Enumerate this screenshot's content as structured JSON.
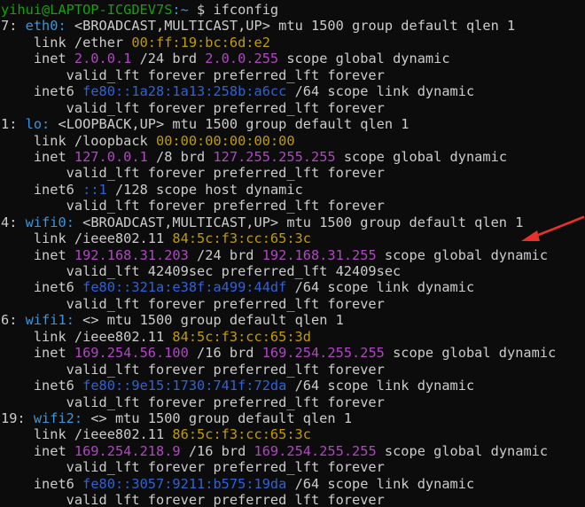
{
  "prompt": {
    "user_host": "yihui@LAPTOP-ICGDEV7S",
    "path": ":~",
    "symbol": " $ ",
    "command": "ifconfig"
  },
  "lines": [
    [
      {
        "t": "7: ",
        "c": "white"
      },
      {
        "t": "eth0:",
        "c": "cyan"
      },
      {
        "t": " <BROADCAST,MULTICAST,UP> mtu 1500 group default qlen 1",
        "c": "white"
      }
    ],
    [
      {
        "t": "    link /ether ",
        "c": "white"
      },
      {
        "t": "00:ff:19:bc:6d:e2",
        "c": "yellow"
      }
    ],
    [
      {
        "t": "    inet ",
        "c": "white"
      },
      {
        "t": "2.0.0.1",
        "c": "magenta"
      },
      {
        "t": " /24 brd ",
        "c": "white"
      },
      {
        "t": "2.0.0.255",
        "c": "magenta"
      },
      {
        "t": " scope global dynamic",
        "c": "white"
      }
    ],
    [
      {
        "t": "        valid_lft forever preferred_lft forever",
        "c": "white"
      }
    ],
    [
      {
        "t": "    inet6 ",
        "c": "white"
      },
      {
        "t": "fe80::1a28:1a13:258b:a6cc",
        "c": "blue"
      },
      {
        "t": " /64 scope link dynamic",
        "c": "white"
      }
    ],
    [
      {
        "t": "        valid_lft forever preferred_lft forever",
        "c": "white"
      }
    ],
    [
      {
        "t": "1: ",
        "c": "white"
      },
      {
        "t": "lo:",
        "c": "cyan"
      },
      {
        "t": " <LOOPBACK,UP> mtu 1500 group default qlen 1",
        "c": "white"
      }
    ],
    [
      {
        "t": "    link /loopback ",
        "c": "white"
      },
      {
        "t": "00:00:00:00:00:00",
        "c": "yellow"
      }
    ],
    [
      {
        "t": "    inet ",
        "c": "white"
      },
      {
        "t": "127.0.0.1",
        "c": "magenta"
      },
      {
        "t": " /8 brd ",
        "c": "white"
      },
      {
        "t": "127.255.255.255",
        "c": "magenta"
      },
      {
        "t": " scope global dynamic",
        "c": "white"
      }
    ],
    [
      {
        "t": "        valid_lft forever preferred_lft forever",
        "c": "white"
      }
    ],
    [
      {
        "t": "    inet6 ",
        "c": "white"
      },
      {
        "t": "::1",
        "c": "blue"
      },
      {
        "t": " /128 scope host dynamic",
        "c": "white"
      }
    ],
    [
      {
        "t": "        valid_lft forever preferred_lft forever",
        "c": "white"
      }
    ],
    [
      {
        "t": "4: ",
        "c": "white"
      },
      {
        "t": "wifi0:",
        "c": "cyan"
      },
      {
        "t": " <BROADCAST,MULTICAST,UP> mtu 1500 group default qlen 1",
        "c": "white"
      }
    ],
    [
      {
        "t": "    link /ieee802.11 ",
        "c": "white"
      },
      {
        "t": "84:5c:f3:cc:65:3c",
        "c": "yellow"
      }
    ],
    [
      {
        "t": "    inet ",
        "c": "white"
      },
      {
        "t": "192.168.31.203",
        "c": "magenta"
      },
      {
        "t": " /24 brd ",
        "c": "white"
      },
      {
        "t": "192.168.31.255",
        "c": "magenta"
      },
      {
        "t": " scope global dynamic",
        "c": "white"
      }
    ],
    [
      {
        "t": "        valid_lft 42409sec preferred_lft 42409sec",
        "c": "white"
      }
    ],
    [
      {
        "t": "    inet6 ",
        "c": "white"
      },
      {
        "t": "fe80::321a:e38f:a499:44df",
        "c": "blue"
      },
      {
        "t": " /64 scope link dynamic",
        "c": "white"
      }
    ],
    [
      {
        "t": "        valid_lft forever preferred_lft forever",
        "c": "white"
      }
    ],
    [
      {
        "t": "6: ",
        "c": "white"
      },
      {
        "t": "wifi1:",
        "c": "cyan"
      },
      {
        "t": " <> mtu 1500 group default qlen 1",
        "c": "white"
      }
    ],
    [
      {
        "t": "    link /ieee802.11 ",
        "c": "white"
      },
      {
        "t": "84:5c:f3:cc:65:3d",
        "c": "yellow"
      }
    ],
    [
      {
        "t": "    inet ",
        "c": "white"
      },
      {
        "t": "169.254.56.100",
        "c": "magenta"
      },
      {
        "t": " /16 brd ",
        "c": "white"
      },
      {
        "t": "169.254.255.255",
        "c": "magenta"
      },
      {
        "t": " scope global dynamic",
        "c": "white"
      }
    ],
    [
      {
        "t": "        valid_lft forever preferred_lft forever",
        "c": "white"
      }
    ],
    [
      {
        "t": "    inet6 ",
        "c": "white"
      },
      {
        "t": "fe80::9e15:1730:741f:72da",
        "c": "blue"
      },
      {
        "t": " /64 scope link dynamic",
        "c": "white"
      }
    ],
    [
      {
        "t": "        valid_lft forever preferred_lft forever",
        "c": "white"
      }
    ],
    [
      {
        "t": "19: ",
        "c": "white"
      },
      {
        "t": "wifi2:",
        "c": "cyan"
      },
      {
        "t": " <> mtu 1500 group default qlen 1",
        "c": "white"
      }
    ],
    [
      {
        "t": "    link /ieee802.11 ",
        "c": "white"
      },
      {
        "t": "86:5c:f3:cc:65:3c",
        "c": "yellow"
      }
    ],
    [
      {
        "t": "    inet ",
        "c": "white"
      },
      {
        "t": "169.254.218.9",
        "c": "magenta"
      },
      {
        "t": " /16 brd ",
        "c": "white"
      },
      {
        "t": "169.254.255.255",
        "c": "magenta"
      },
      {
        "t": " scope global dynamic",
        "c": "white"
      }
    ],
    [
      {
        "t": "        valid_lft forever preferred_lft forever",
        "c": "white"
      }
    ],
    [
      {
        "t": "    inet6 ",
        "c": "white"
      },
      {
        "t": "fe80::3057:9211:b575:19da",
        "c": "blue"
      },
      {
        "t": " /64 scope link dynamic",
        "c": "white"
      }
    ],
    [
      {
        "t": "        valid_lft forever preferred_lft forever",
        "c": "white"
      }
    ]
  ],
  "annotation": {
    "icon": "red-arrow-icon",
    "color": "#e8312a"
  },
  "colors": {
    "background": "#0c0c0c",
    "text": "#cccccc",
    "prompt": "#13a10e",
    "interface": "#3a96dd",
    "mac": "#c19c00",
    "ipv4": "#b146c2",
    "ipv6": "#2f62d8"
  }
}
